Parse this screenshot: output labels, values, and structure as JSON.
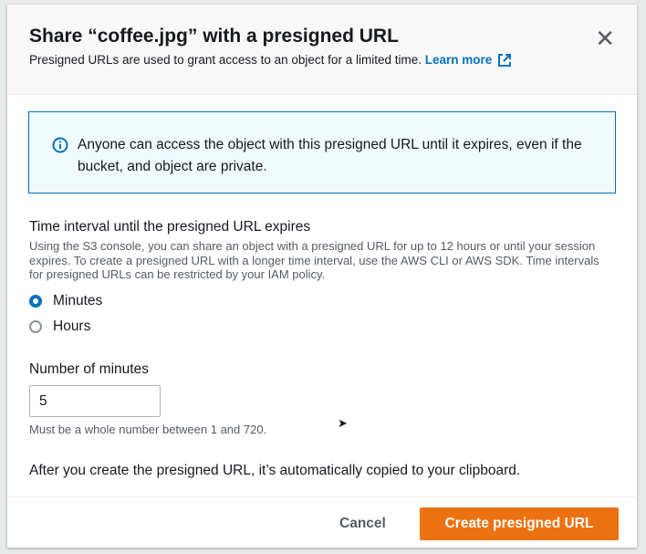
{
  "modal": {
    "title": "Share “coffee.jpg” with a presigned URL",
    "subtitle": "Presigned URLs are used to grant access to an object for a limited time.",
    "learn_more": "Learn more"
  },
  "info": {
    "text": "Anyone can access the object with this presigned URL until it expires, even if the bucket, and object are private."
  },
  "interval": {
    "label": "Time interval until the presigned URL expires",
    "description": "Using the S3 console, you can share an object with a presigned URL for up to 12 hours or until your session expires. To create a presigned URL with a longer time interval, use the AWS CLI or AWS SDK. Time intervals for presigned URLs can be restricted by your IAM policy.",
    "options": [
      {
        "label": "Minutes",
        "selected": true
      },
      {
        "label": "Hours",
        "selected": false
      }
    ]
  },
  "minutes": {
    "label": "Number of minutes",
    "value": "5",
    "hint": "Must be a whole number between 1 and 720."
  },
  "note": "After you create the presigned URL, it’s automatically copied to your clipboard.",
  "footer": {
    "cancel": "Cancel",
    "create": "Create presigned URL"
  },
  "colors": {
    "accent": "#0073bb",
    "primary": "#ec7211"
  }
}
